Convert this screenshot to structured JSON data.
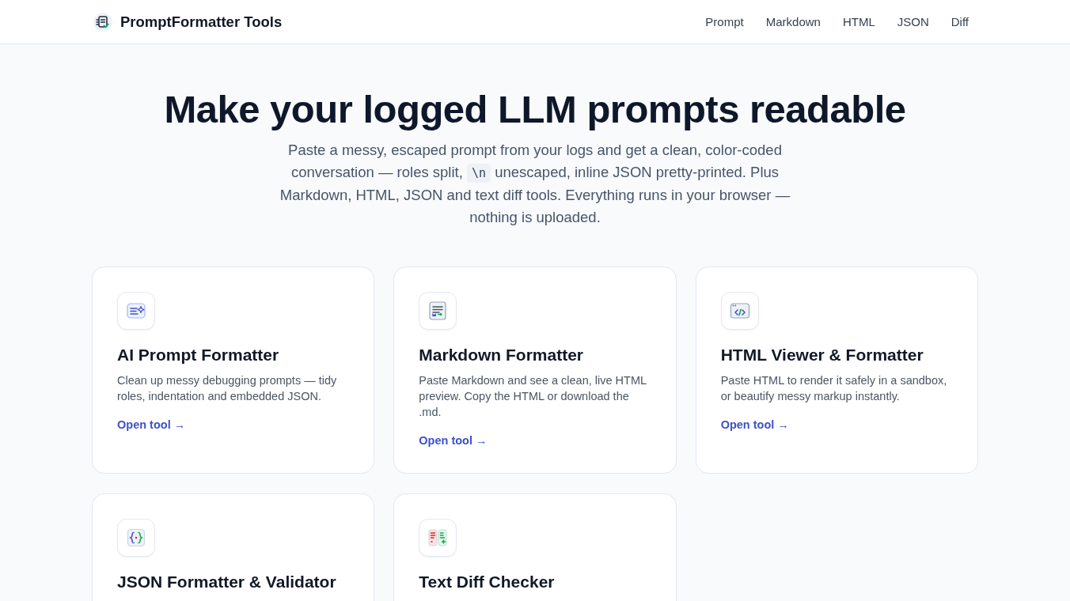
{
  "header": {
    "brand": "PromptFormatter Tools",
    "nav": [
      "Prompt",
      "Markdown",
      "HTML",
      "JSON",
      "Diff"
    ]
  },
  "hero": {
    "title": "Make your logged LLM prompts readable",
    "intro": [
      {
        "kind": "text",
        "text": "Paste a messy, escaped prompt from your logs and get a clean, color-coded conversation — roles split, "
      },
      {
        "kind": "code",
        "text": "\\n"
      },
      {
        "kind": "text",
        "text": " unescaped, inline JSON pretty-printed. Plus Markdown, HTML, JSON and text diff tools. Everything runs in your browser — nothing is uploaded."
      }
    ]
  },
  "cards": [
    {
      "kind": "prompt",
      "title": "AI Prompt Formatter",
      "description": "Clean up messy debugging prompts — tidy roles, indentation and embedded JSON.",
      "link": "Open tool →"
    },
    {
      "kind": "markdown",
      "title": "Markdown Formatter",
      "description": "Paste Markdown and see a clean, live HTML preview. Copy the HTML or download the .md.",
      "link": "Open tool →"
    },
    {
      "kind": "html",
      "title": "HTML Viewer & Formatter",
      "description": "Paste HTML to render it safely in a sandbox, or beautify messy markup instantly.",
      "link": "Open tool →"
    },
    {
      "kind": "json",
      "title": "JSON Formatter & Validator"
    },
    {
      "kind": "diff",
      "title": "Text Diff Checker"
    }
  ]
}
